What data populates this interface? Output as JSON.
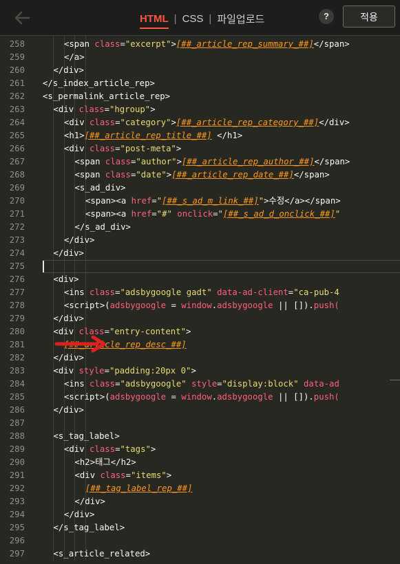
{
  "header": {
    "back_icon": "back-arrow-icon",
    "tabs": [
      {
        "label": "HTML",
        "active": true
      },
      {
        "label": "CSS",
        "active": false
      },
      {
        "label": "파일업로드",
        "active": false
      }
    ],
    "separator": "|",
    "help_label": "?",
    "apply_label": "적용",
    "accent_color": "#ff5544"
  },
  "editor": {
    "theme_colors": {
      "background": "#272822",
      "attr": "#ff5f7e",
      "string": "#e6db74",
      "variable": "#fd971f"
    },
    "annotation": {
      "type": "red-arrow",
      "points_to_line": "281",
      "color": "#e02020"
    },
    "lines": [
      {
        "num": "258",
        "indent": 2,
        "tokens": [
          {
            "t": "<span ",
            "c": "tag"
          },
          {
            "t": "class",
            "c": "attr"
          },
          {
            "t": "=",
            "c": "tag"
          },
          {
            "t": "\"excerpt\"",
            "c": "str"
          },
          {
            "t": ">",
            "c": "tag"
          },
          {
            "t": "[##_article_rep_summary_##]",
            "c": "var"
          },
          {
            "t": "</span>",
            "c": "tag"
          }
        ]
      },
      {
        "num": "259",
        "indent": 2,
        "tokens": [
          {
            "t": "</a>",
            "c": "tag"
          }
        ]
      },
      {
        "num": "260",
        "indent": 1,
        "tokens": [
          {
            "t": "</div>",
            "c": "tag"
          }
        ]
      },
      {
        "num": "261",
        "indent": 0,
        "tokens": [
          {
            "t": "</s_index_article_rep>",
            "c": "tag"
          }
        ]
      },
      {
        "num": "262",
        "indent": 0,
        "tokens": [
          {
            "t": "<s_permalink_article_rep>",
            "c": "tag"
          }
        ]
      },
      {
        "num": "263",
        "indent": 1,
        "tokens": [
          {
            "t": "<div ",
            "c": "tag"
          },
          {
            "t": "class",
            "c": "attr"
          },
          {
            "t": "=",
            "c": "tag"
          },
          {
            "t": "\"hgroup\"",
            "c": "str"
          },
          {
            "t": ">",
            "c": "tag"
          }
        ]
      },
      {
        "num": "264",
        "indent": 2,
        "tokens": [
          {
            "t": "<div ",
            "c": "tag"
          },
          {
            "t": "class",
            "c": "attr"
          },
          {
            "t": "=",
            "c": "tag"
          },
          {
            "t": "\"category\"",
            "c": "str"
          },
          {
            "t": ">",
            "c": "tag"
          },
          {
            "t": "[##_article_rep_category_##]",
            "c": "var"
          },
          {
            "t": "</div>",
            "c": "tag"
          }
        ]
      },
      {
        "num": "265",
        "indent": 2,
        "tokens": [
          {
            "t": "<h1>",
            "c": "tag"
          },
          {
            "t": "[##_article_rep_title_##]",
            "c": "var"
          },
          {
            "t": " </h1>",
            "c": "tag"
          }
        ]
      },
      {
        "num": "266",
        "indent": 2,
        "tokens": [
          {
            "t": "<div ",
            "c": "tag"
          },
          {
            "t": "class",
            "c": "attr"
          },
          {
            "t": "=",
            "c": "tag"
          },
          {
            "t": "\"post-meta\"",
            "c": "str"
          },
          {
            "t": ">",
            "c": "tag"
          }
        ]
      },
      {
        "num": "267",
        "indent": 3,
        "tokens": [
          {
            "t": "<span ",
            "c": "tag"
          },
          {
            "t": "class",
            "c": "attr"
          },
          {
            "t": "=",
            "c": "tag"
          },
          {
            "t": "\"author\"",
            "c": "str"
          },
          {
            "t": ">",
            "c": "tag"
          },
          {
            "t": "[##_article_rep_author_##]",
            "c": "var"
          },
          {
            "t": "</span>",
            "c": "tag"
          }
        ]
      },
      {
        "num": "268",
        "indent": 3,
        "tokens": [
          {
            "t": "<span ",
            "c": "tag"
          },
          {
            "t": "class",
            "c": "attr"
          },
          {
            "t": "=",
            "c": "tag"
          },
          {
            "t": "\"date\"",
            "c": "str"
          },
          {
            "t": ">",
            "c": "tag"
          },
          {
            "t": "[##_article_rep_date_##]",
            "c": "var"
          },
          {
            "t": "</span>",
            "c": "tag"
          }
        ]
      },
      {
        "num": "269",
        "indent": 3,
        "tokens": [
          {
            "t": "<s_ad_div>",
            "c": "tag"
          }
        ]
      },
      {
        "num": "270",
        "indent": 4,
        "tokens": [
          {
            "t": "<span><a ",
            "c": "tag"
          },
          {
            "t": "href",
            "c": "attr"
          },
          {
            "t": "=",
            "c": "tag"
          },
          {
            "t": "\"",
            "c": "str"
          },
          {
            "t": "[##_s_ad_m_link_##]",
            "c": "var"
          },
          {
            "t": "\"",
            "c": "str"
          },
          {
            "t": ">수정</a></span>",
            "c": "tag"
          }
        ]
      },
      {
        "num": "271",
        "indent": 4,
        "tokens": [
          {
            "t": "<span><a ",
            "c": "tag"
          },
          {
            "t": "href",
            "c": "attr"
          },
          {
            "t": "=",
            "c": "tag"
          },
          {
            "t": "\"#\"",
            "c": "str"
          },
          {
            "t": " ",
            "c": "tag"
          },
          {
            "t": "onclick",
            "c": "attr"
          },
          {
            "t": "=",
            "c": "tag"
          },
          {
            "t": "\"",
            "c": "str"
          },
          {
            "t": "[##_s_ad_d_onclick_##]",
            "c": "var"
          },
          {
            "t": "\"",
            "c": "str"
          }
        ]
      },
      {
        "num": "272",
        "indent": 3,
        "tokens": [
          {
            "t": "</s_ad_div>",
            "c": "tag"
          }
        ]
      },
      {
        "num": "273",
        "indent": 2,
        "tokens": [
          {
            "t": "</div>",
            "c": "tag"
          }
        ]
      },
      {
        "num": "274",
        "indent": 1,
        "tokens": [
          {
            "t": "</div>",
            "c": "tag"
          }
        ]
      },
      {
        "num": "275",
        "indent": 0,
        "tokens": [],
        "current": true
      },
      {
        "num": "276",
        "indent": 1,
        "tokens": [
          {
            "t": "<div>",
            "c": "tag"
          }
        ]
      },
      {
        "num": "277",
        "indent": 2,
        "tokens": [
          {
            "t": "<ins ",
            "c": "tag"
          },
          {
            "t": "class",
            "c": "attr"
          },
          {
            "t": "=",
            "c": "tag"
          },
          {
            "t": "\"adsbygoogle gadt\"",
            "c": "str"
          },
          {
            "t": " ",
            "c": "tag"
          },
          {
            "t": "data-ad-client",
            "c": "attr"
          },
          {
            "t": "=",
            "c": "tag"
          },
          {
            "t": "\"ca-pub-4",
            "c": "str"
          }
        ]
      },
      {
        "num": "278",
        "indent": 2,
        "tokens": [
          {
            "t": "<script>",
            "c": "tag"
          },
          {
            "t": "(",
            "c": "plain"
          },
          {
            "t": "adsbygoogle",
            "c": "attr"
          },
          {
            "t": " = ",
            "c": "plain"
          },
          {
            "t": "window",
            "c": "attr"
          },
          {
            "t": ".",
            "c": "plain"
          },
          {
            "t": "adsbygoogle",
            "c": "attr"
          },
          {
            "t": " || []).",
            "c": "plain"
          },
          {
            "t": "push(",
            "c": "attr"
          }
        ]
      },
      {
        "num": "279",
        "indent": 1,
        "tokens": [
          {
            "t": "</div>",
            "c": "tag"
          }
        ]
      },
      {
        "num": "280",
        "indent": 1,
        "tokens": [
          {
            "t": "<div ",
            "c": "tag"
          },
          {
            "t": "class",
            "c": "attr"
          },
          {
            "t": "=",
            "c": "tag"
          },
          {
            "t": "\"entry-content\"",
            "c": "str"
          },
          {
            "t": ">",
            "c": "tag"
          }
        ]
      },
      {
        "num": "281",
        "indent": 2,
        "tokens": [
          {
            "t": "[##_article_rep_desc_##]",
            "c": "var"
          }
        ]
      },
      {
        "num": "282",
        "indent": 1,
        "tokens": [
          {
            "t": "</div>",
            "c": "tag"
          }
        ]
      },
      {
        "num": "283",
        "indent": 1,
        "tokens": [
          {
            "t": "<div ",
            "c": "tag"
          },
          {
            "t": "style",
            "c": "attr"
          },
          {
            "t": "=",
            "c": "tag"
          },
          {
            "t": "\"padding:20px 0\"",
            "c": "str"
          },
          {
            "t": ">",
            "c": "tag"
          }
        ]
      },
      {
        "num": "284",
        "indent": 2,
        "tokens": [
          {
            "t": "<ins ",
            "c": "tag"
          },
          {
            "t": "class",
            "c": "attr"
          },
          {
            "t": "=",
            "c": "tag"
          },
          {
            "t": "\"adsbygoogle\"",
            "c": "str"
          },
          {
            "t": " ",
            "c": "tag"
          },
          {
            "t": "style",
            "c": "attr"
          },
          {
            "t": "=",
            "c": "tag"
          },
          {
            "t": "\"display:block\"",
            "c": "str"
          },
          {
            "t": " ",
            "c": "tag"
          },
          {
            "t": "data-ad",
            "c": "attr"
          }
        ]
      },
      {
        "num": "285",
        "indent": 2,
        "tokens": [
          {
            "t": "<script>",
            "c": "tag"
          },
          {
            "t": "(",
            "c": "plain"
          },
          {
            "t": "adsbygoogle",
            "c": "attr"
          },
          {
            "t": " = ",
            "c": "plain"
          },
          {
            "t": "window",
            "c": "attr"
          },
          {
            "t": ".",
            "c": "plain"
          },
          {
            "t": "adsbygoogle",
            "c": "attr"
          },
          {
            "t": " || []).",
            "c": "plain"
          },
          {
            "t": "push(",
            "c": "attr"
          }
        ]
      },
      {
        "num": "286",
        "indent": 1,
        "tokens": [
          {
            "t": "</div>",
            "c": "tag"
          }
        ]
      },
      {
        "num": "287",
        "indent": 0,
        "tokens": []
      },
      {
        "num": "288",
        "indent": 1,
        "tokens": [
          {
            "t": "<s_tag_label>",
            "c": "tag"
          }
        ]
      },
      {
        "num": "289",
        "indent": 2,
        "tokens": [
          {
            "t": "<div ",
            "c": "tag"
          },
          {
            "t": "class",
            "c": "attr"
          },
          {
            "t": "=",
            "c": "tag"
          },
          {
            "t": "\"tags\"",
            "c": "str"
          },
          {
            "t": ">",
            "c": "tag"
          }
        ]
      },
      {
        "num": "290",
        "indent": 3,
        "tokens": [
          {
            "t": "<h2>",
            "c": "tag"
          },
          {
            "t": "태그",
            "c": "plain"
          },
          {
            "t": "</h2>",
            "c": "tag"
          }
        ]
      },
      {
        "num": "291",
        "indent": 3,
        "tokens": [
          {
            "t": "<div ",
            "c": "tag"
          },
          {
            "t": "class",
            "c": "attr"
          },
          {
            "t": "=",
            "c": "tag"
          },
          {
            "t": "\"items\"",
            "c": "str"
          },
          {
            "t": ">",
            "c": "tag"
          }
        ]
      },
      {
        "num": "292",
        "indent": 4,
        "tokens": [
          {
            "t": "[##_tag_label_rep_##]",
            "c": "var"
          }
        ]
      },
      {
        "num": "293",
        "indent": 3,
        "tokens": [
          {
            "t": "</div>",
            "c": "tag"
          }
        ]
      },
      {
        "num": "294",
        "indent": 2,
        "tokens": [
          {
            "t": "</div>",
            "c": "tag"
          }
        ]
      },
      {
        "num": "295",
        "indent": 1,
        "tokens": [
          {
            "t": "</s_tag_label>",
            "c": "tag"
          }
        ]
      },
      {
        "num": "296",
        "indent": 0,
        "tokens": []
      },
      {
        "num": "297",
        "indent": 1,
        "tokens": [
          {
            "t": "<s_article_related>",
            "c": "tag"
          }
        ]
      }
    ]
  }
}
